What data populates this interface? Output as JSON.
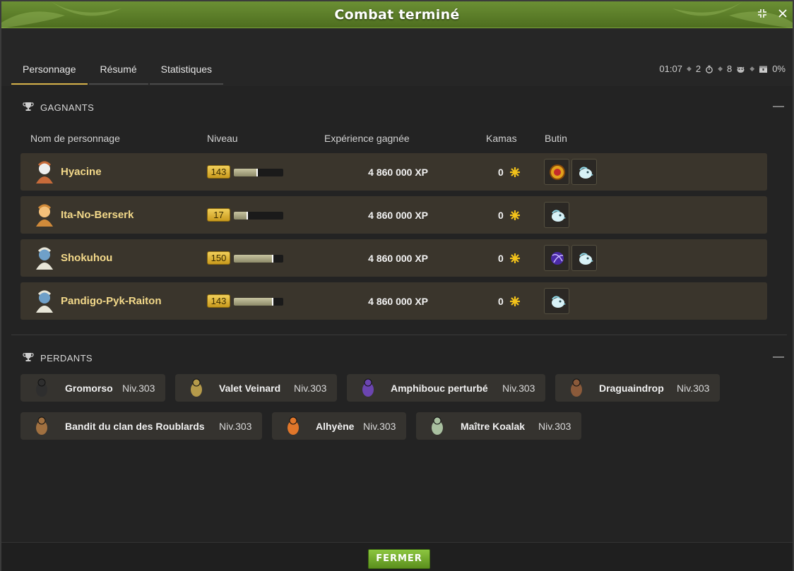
{
  "window": {
    "title": "Combat terminé"
  },
  "tabs": [
    {
      "label": "Personnage",
      "active": true
    },
    {
      "label": "Résumé",
      "active": false
    },
    {
      "label": "Statistiques",
      "active": false
    }
  ],
  "stats": {
    "duration": "01:07",
    "turns": "2",
    "monsters": "8",
    "challenge": "0%"
  },
  "winners": {
    "header": "GAGNANTS",
    "columns": {
      "name": "Nom de personnage",
      "level": "Niveau",
      "xp": "Expérience gagnée",
      "kamas": "Kamas",
      "loot": "Butin"
    },
    "rows": [
      {
        "name": "Hyacine",
        "level": "143",
        "level_progress": 0.48,
        "xp": "4 860 000 XP",
        "kamas": "0",
        "loot": [
          "medallion-icon",
          "ghost-bird-icon"
        ]
      },
      {
        "name": "Ita-No-Berserk",
        "level": "17",
        "level_progress": 0.28,
        "xp": "4 860 000 XP",
        "kamas": "0",
        "loot": [
          "ghost-bird-icon"
        ]
      },
      {
        "name": "Shokuhou",
        "level": "150",
        "level_progress": 0.8,
        "xp": "4 860 000 XP",
        "kamas": "0",
        "loot": [
          "purple-orb-icon",
          "ghost-bird-icon"
        ]
      },
      {
        "name": "Pandigo-Pyk-Raiton",
        "level": "143",
        "level_progress": 0.8,
        "xp": "4 860 000 XP",
        "kamas": "0",
        "loot": [
          "ghost-bird-icon"
        ]
      }
    ]
  },
  "losers": {
    "header": "PERDANTS",
    "monsters": [
      {
        "name": "Gromorso",
        "level": "Niv.303"
      },
      {
        "name": "Valet Veinard",
        "level": "Niv.303"
      },
      {
        "name": "Amphibouc perturbé",
        "level": "Niv.303"
      },
      {
        "name": "Draguaindrop",
        "level": "Niv.303"
      },
      {
        "name": "Bandit du clan des Roublards",
        "level": "Niv.303"
      },
      {
        "name": "Alhyène",
        "level": "Niv.303"
      },
      {
        "name": "Maître Koalak",
        "level": "Niv.303"
      }
    ]
  },
  "footer": {
    "close_label": "FERMER"
  },
  "colors": {
    "accent": "#d6b24a",
    "title_green": "#5b7f28",
    "name_gold": "#f3d98a",
    "button_green": "#7cb236"
  }
}
